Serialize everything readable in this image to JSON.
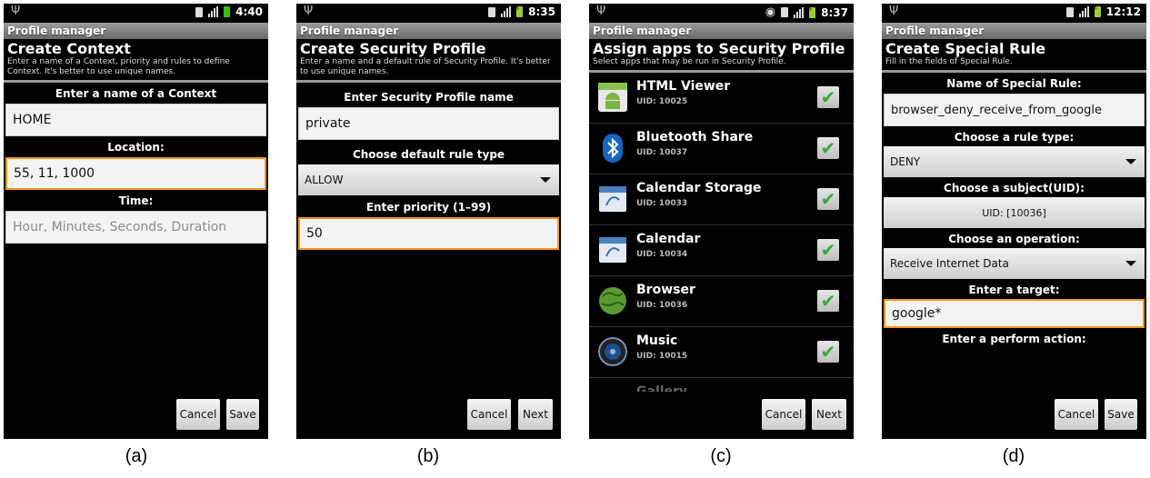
{
  "app_title": "Profile manager",
  "captions": [
    "(a)",
    "(b)",
    "(c)",
    "(d)"
  ],
  "screen_a": {
    "time": "4:40",
    "title": "Create Context",
    "subtitle": "Enter a name of a Context, priority and rules to define Context. It's better to use unique names.",
    "name_label": "Enter a name of a Context",
    "name_value": "HOME",
    "location_label": "Location:",
    "location_value": "55, 11, 1000",
    "time_label": "Time:",
    "time_placeholder": "Hour, Minutes, Seconds, Duration",
    "cancel": "Cancel",
    "save": "Save"
  },
  "screen_b": {
    "time": "8:35",
    "title": "Create Security Profile",
    "subtitle": "Enter a name and a default rule of Security Profile. It's better to use unique names.",
    "name_label": "Enter Security Profile name",
    "name_value": "private",
    "rule_label": "Choose default rule type",
    "rule_value": "ALLOW",
    "priority_label": "Enter priority (1–99)",
    "priority_value": "50",
    "cancel": "Cancel",
    "next": "Next"
  },
  "screen_c": {
    "time": "8:37",
    "title": "Assign apps to Security Profile",
    "subtitle": "Select apps that may be run in Security Profile.",
    "apps": [
      {
        "name": "HTML Viewer",
        "uid": "UID: 10025",
        "icon": "android-icon"
      },
      {
        "name": "Bluetooth Share",
        "uid": "UID: 10037",
        "icon": "bluetooth-icon"
      },
      {
        "name": "Calendar Storage",
        "uid": "UID: 10033",
        "icon": "calendar-icon"
      },
      {
        "name": "Calendar",
        "uid": "UID: 10034",
        "icon": "calendar-icon"
      },
      {
        "name": "Browser",
        "uid": "UID: 10036",
        "icon": "globe-icon"
      },
      {
        "name": "Music",
        "uid": "UID: 10015",
        "icon": "speaker-icon"
      },
      {
        "name": "Gallery",
        "uid": "",
        "icon": "gallery-icon"
      }
    ],
    "cancel": "Cancel",
    "next": "Next"
  },
  "screen_d": {
    "time": "12:12",
    "title": "Create Special Rule",
    "subtitle": "Fill in the fields of Special Rule.",
    "name_label": "Name of Special Rule:",
    "name_value": "browser_deny_receive_from_google",
    "type_label": "Choose a rule type:",
    "type_value": "DENY",
    "subject_label": "Choose a subject(UID):",
    "subject_value": "UID: [10036]",
    "operation_label": "Choose an operation:",
    "operation_value": "Receive Internet Data",
    "target_label": "Enter a target:",
    "target_value": "google*",
    "action_label": "Enter a perform action:",
    "cancel": "Cancel",
    "save": "Save"
  }
}
